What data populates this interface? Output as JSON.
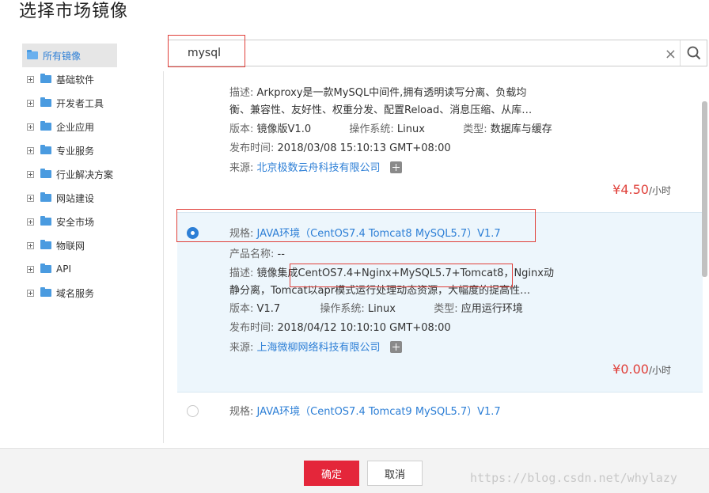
{
  "dialog": {
    "title": "选择市场镜像"
  },
  "sidebar": {
    "root": {
      "label": "所有镜像"
    },
    "items": [
      {
        "label": "基础软件"
      },
      {
        "label": "开发者工具"
      },
      {
        "label": "企业应用"
      },
      {
        "label": "专业服务"
      },
      {
        "label": "行业解决方案"
      },
      {
        "label": "网站建设"
      },
      {
        "label": "安全市场"
      },
      {
        "label": "物联网"
      },
      {
        "label": "API"
      },
      {
        "label": "域名服务"
      }
    ]
  },
  "search": {
    "value": "mysql",
    "clear_icon": "×"
  },
  "results": [
    {
      "desc_label": "描述:",
      "desc_line1": "Arkproxy是一款MySQL中间件,拥有透明读写分离、负载均",
      "desc_line2": "衡、兼容性、友好性、权重分发、配置Reload、消息压缩、从库…",
      "version_label": "版本:",
      "version": "镜像版V1.0",
      "os_label": "操作系统:",
      "os": "Linux",
      "type_label": "类型:",
      "type": "数据库与缓存",
      "release_label": "发布时间:",
      "release": "2018/03/08 15:10:13 GMT+08:00",
      "source_label": "来源:",
      "source": "北京极数云舟科技有限公司",
      "price": "¥4.50",
      "price_unit": "/小时"
    },
    {
      "spec_label": "规格:",
      "spec": "JAVA环境（CentOS7.4 Tomcat8 MySQL5.7）V1.7",
      "product_label": "产品名称:",
      "product": "--",
      "desc_label": "描述:",
      "desc_line1": "镜像集成CentOS7.4+Nginx+MySQL5.7+Tomcat8，Nginx动",
      "desc_line2": "静分离，Tomcat以apr模式运行处理动态资源，大幅度的提高性…",
      "version_label": "版本:",
      "version": "V1.7",
      "os_label": "操作系统:",
      "os": "Linux",
      "type_label": "类型:",
      "type": "应用运行环境",
      "release_label": "发布时间:",
      "release": "2018/04/12 10:10:10 GMT+08:00",
      "source_label": "来源:",
      "source": "上海微柳网络科技有限公司",
      "price": "¥0.00",
      "price_unit": "/小时"
    },
    {
      "spec_label": "规格:",
      "spec": "JAVA环境（CentOS7.4 Tomcat9 MySQL5.7）V1.7"
    }
  ],
  "footer": {
    "ok_label": "确定",
    "cancel_label": "取消",
    "watermark": "https://blog.csdn.net/whylazy"
  },
  "colors": {
    "accent": "#2d7fd6",
    "price": "#e0403a",
    "primary_button": "#e4263a"
  }
}
